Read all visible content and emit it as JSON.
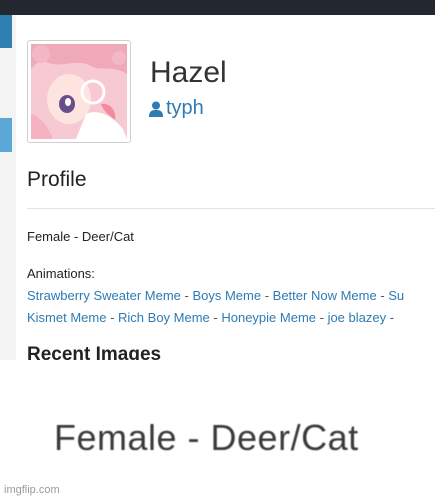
{
  "profile": {
    "display_name": "Hazel",
    "username": "typh",
    "section_heading": "Profile",
    "bio": "Female - Deer/Cat",
    "animations_label": "Animations:",
    "separator": " - ",
    "animations_line1": [
      "Strawberry Sweater Meme",
      "Boys Meme",
      "Better Now Meme",
      "Su"
    ],
    "animations_line2": [
      "Kismet Meme",
      "Rich Boy Meme",
      "Honeypie Meme",
      "joe blazey"
    ],
    "recent_heading": "Recent Images"
  },
  "zoom": {
    "text": "Female - Deer/Cat"
  },
  "watermark": "imgflip.com",
  "colors": {
    "link": "#2d7bb5",
    "topbar": "#23272e",
    "accent": "#2f7fb3"
  }
}
